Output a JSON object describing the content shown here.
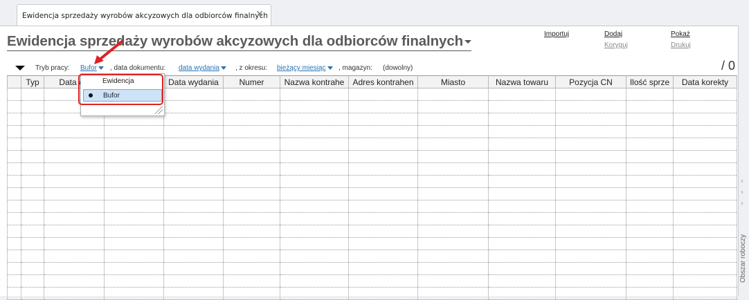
{
  "tab": {
    "label": "Ewidencja sprzedaży wyrobów akcyzowych dla odbiorców finalnych",
    "close": "✕"
  },
  "title": "Ewidencja sprzedaży wyrobów akcyzowych dla odbiorców finalnych",
  "actions": {
    "import": "Importuj",
    "add": "Dodaj",
    "correct": "Koryguj",
    "show": "Pokaż",
    "print": "Drukuj"
  },
  "filters": {
    "mode_label": "Tryb pracy:",
    "mode_value": "Bufor",
    "doc_date_label": ", data dokumentu:",
    "doc_date_value": "data wydania",
    "period_label": ", z okresu:",
    "period_value": "bieżący miesiąc",
    "warehouse_label": ", magazyn:",
    "warehouse_value": "(dowolny)"
  },
  "count": "/ 0",
  "table": {
    "columns": [
      "",
      "Typ",
      "Data wy",
      "",
      "Data wydania",
      "Numer",
      "Nazwa kontrahe",
      "Adres kontrahen",
      "Miasto",
      "Nazwa towaru",
      "Pozycja CN",
      "Ilość sprze",
      "Data korekty"
    ],
    "row_count": 17
  },
  "dropdown": {
    "items": [
      {
        "label": "Ewidencja",
        "selected": false
      },
      {
        "label": "Bufor",
        "selected": true
      }
    ]
  },
  "sidebar": {
    "label": "Obszar roboczy",
    "chevron": "›"
  },
  "colors": {
    "accent": "#2573b6",
    "highlight": "#e02020",
    "selected_bg": "#cde3f7"
  }
}
